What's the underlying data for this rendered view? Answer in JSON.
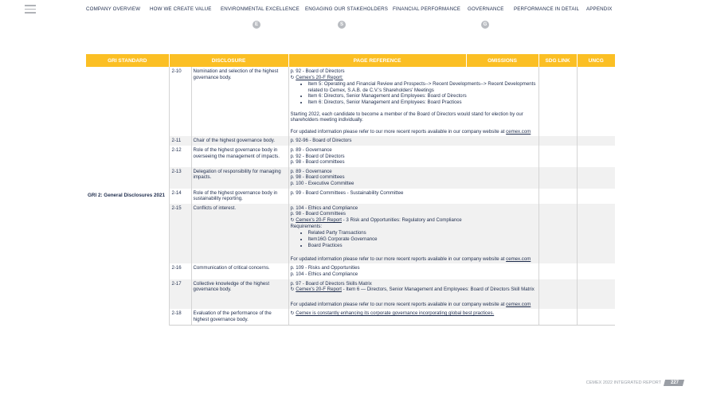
{
  "nav": {
    "items": [
      {
        "label": "COMPANY OVERVIEW"
      },
      {
        "label": "HOW WE CREATE VALUE"
      },
      {
        "label": "ENVIRONMENTAL EXCELLENCE",
        "badge": "E"
      },
      {
        "label": "ENGAGING OUR STAKEHOLDERS",
        "badge": "S"
      },
      {
        "label": "FINANCIAL PERFORMANCE"
      },
      {
        "label": "GOVERNANCE",
        "badge": "G"
      },
      {
        "label": "PERFORMANCE IN DETAIL"
      },
      {
        "label": "APPENDIX"
      }
    ]
  },
  "table": {
    "headers": {
      "gri": "GRI STANDARD",
      "disclosure": "DISCLOSURE",
      "page": "PAGE REFERENCE",
      "omissions": "OMISSIONS",
      "sdg": "SDG LINK",
      "ungc": "UNCG"
    },
    "gri_standard": "GRI 2: General Disclosures 2021",
    "rows": [
      {
        "num": "2-10",
        "disclosure": "Nomination and selection of the highest governance body.",
        "refs": [
          "p. 92 - Board of Directors"
        ],
        "link": "Cemex's 20-F Report:",
        "link_suffix": "",
        "bullets": [
          "Item 5: Operating and Financial Review and Prospects--> Recent Developments--> Recent Developments related to Cemex, S.A.B. de C.V.'s Shareholders' Meetings",
          "Item 6: Directors, Senior Management and Employees: Board of Directors",
          "Item 6: Directors, Senior Management and Employees: Board Practices"
        ],
        "para": "Starting 2022, each candidate to become a member of the Board of Directors would stand for election by our shareholders meeting individually.",
        "note": "For updated information please refer to our more recent reports available in our company website at ",
        "note_link": "cemex.com"
      },
      {
        "num": "2-11",
        "disclosure": "Chair of the highest governance body.",
        "refs": [
          "p. 92-96 - Board of Directors"
        ]
      },
      {
        "num": "2-12",
        "disclosure": "Role of the highest governance body in overseeing the management of impacts.",
        "refs": [
          "p. 89 - Governance",
          "p. 92 - Board of Directors",
          "p. 98 - Board committees"
        ]
      },
      {
        "num": "2-13",
        "disclosure": "Delegation of responsibility for managing impacts.",
        "refs": [
          "p. 89 - Governance",
          "p. 98 - Board committees",
          "p. 100 - Executive Committee"
        ]
      },
      {
        "num": "2-14",
        "disclosure": "Role of the highest governance body in sustainability reporting.",
        "refs": [
          "p. 99 - Board Committees - Sustainability Committee"
        ]
      },
      {
        "num": "2-15",
        "disclosure": "Conflicts of interest.",
        "refs": [
          "p. 104 - Ethics and Compliance",
          "p. 98 - Board Committees"
        ],
        "link": "Cemex's 20-F Report",
        "link_suffix": " - 3 Risk and Opportunities: Regulatory and Compliance",
        "req": "Requirements:",
        "bullets": [
          "Related Party Transactions",
          "Item16G Corporate Governance",
          "Board Practices"
        ],
        "note": "For updated information please refer to our more recent reports available in our company website at ",
        "note_link": "cemex.com"
      },
      {
        "num": "2-16",
        "disclosure": "Communication of critical concerns.",
        "refs": [
          "p. 109 - Risks and Opportunities",
          "p. 104 - Ethics and Compliance"
        ]
      },
      {
        "num": "2-17",
        "disclosure": "Collective knowledge of the highest governance body.",
        "refs": [
          "p. 97 - Board of Directors Skills Matrix"
        ],
        "link": "Cemex's 20-F Report",
        "link_suffix": " - Item 6 — Directors, Senior Management and Employees: Board of Directors Skill Matrix",
        "note": "For updated information please refer to our more recent reports available in our company website at ",
        "note_link": "cemex.com"
      },
      {
        "num": "2-18",
        "disclosure": "Evaluation of the performance of the highest governance body.",
        "link": "Cemex is constantly enhancing its corporate governance incorporating global best practices."
      }
    ]
  },
  "footer": {
    "text": "CEMEX 2022 INTEGRATED REPORT",
    "page": "227"
  }
}
